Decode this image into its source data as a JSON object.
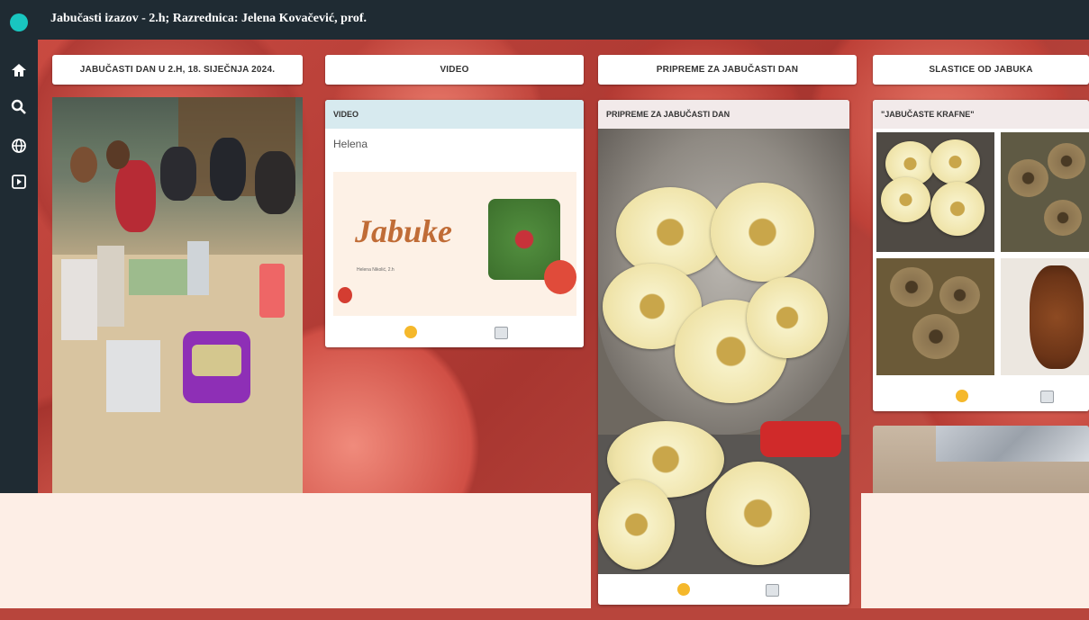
{
  "header": {
    "title": "Jabučasti izazov - 2.h; Razrednica: Jelena Kovačević, prof."
  },
  "nav": {
    "items": [
      "home-icon",
      "search-icon",
      "globe-icon",
      "present-icon"
    ]
  },
  "columns": [
    {
      "label": "JABUČASTI DAN U 2.H, 18. SIJEČNJA 2024."
    },
    {
      "label": "VIDEO"
    },
    {
      "label": "PRIPREME ZA JABUČASTI DAN"
    },
    {
      "label": "SLASTICE OD JABUKA"
    }
  ],
  "cards": {
    "video": {
      "title": "VIDEO",
      "author": "Helena",
      "thumb_title": "Jabuke",
      "thumb_caption": "Helena Nikolić, 2.h"
    },
    "pripreme": {
      "title": "PRIPREME ZA JABUČASTI DAN"
    },
    "krafne": {
      "title": "\"JABUČASTE KRAFNE\""
    }
  },
  "colors": {
    "topbar": "#1f2b33",
    "accent": "#19c6c0",
    "panel": "#fdeee6",
    "reaction": "#f5b82b"
  }
}
